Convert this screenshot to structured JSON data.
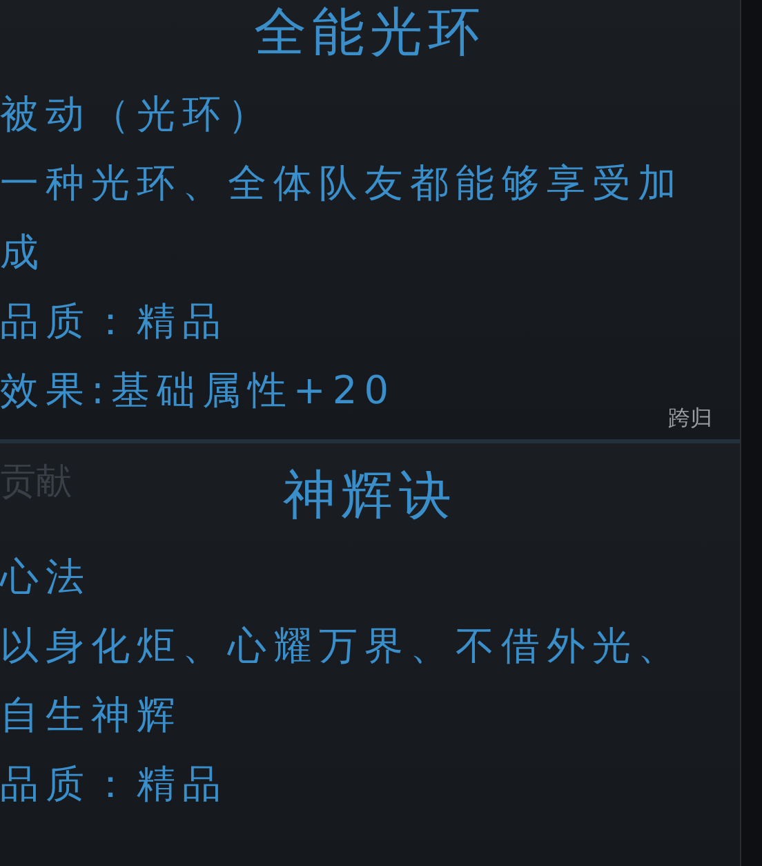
{
  "panels": [
    {
      "title": "全能光环",
      "type": "被动（光环）",
      "description": "一种光环、全体队友都能够享受加成",
      "quality": "品质：精品",
      "effect": "效果:基础属性+20",
      "corner_label": "跨归"
    },
    {
      "faded_label": "贡献",
      "title": "神辉诀",
      "type": "心法",
      "description": "以身化炬、心耀万界、不借外光、自生神辉",
      "quality": "品质：精品"
    }
  ]
}
